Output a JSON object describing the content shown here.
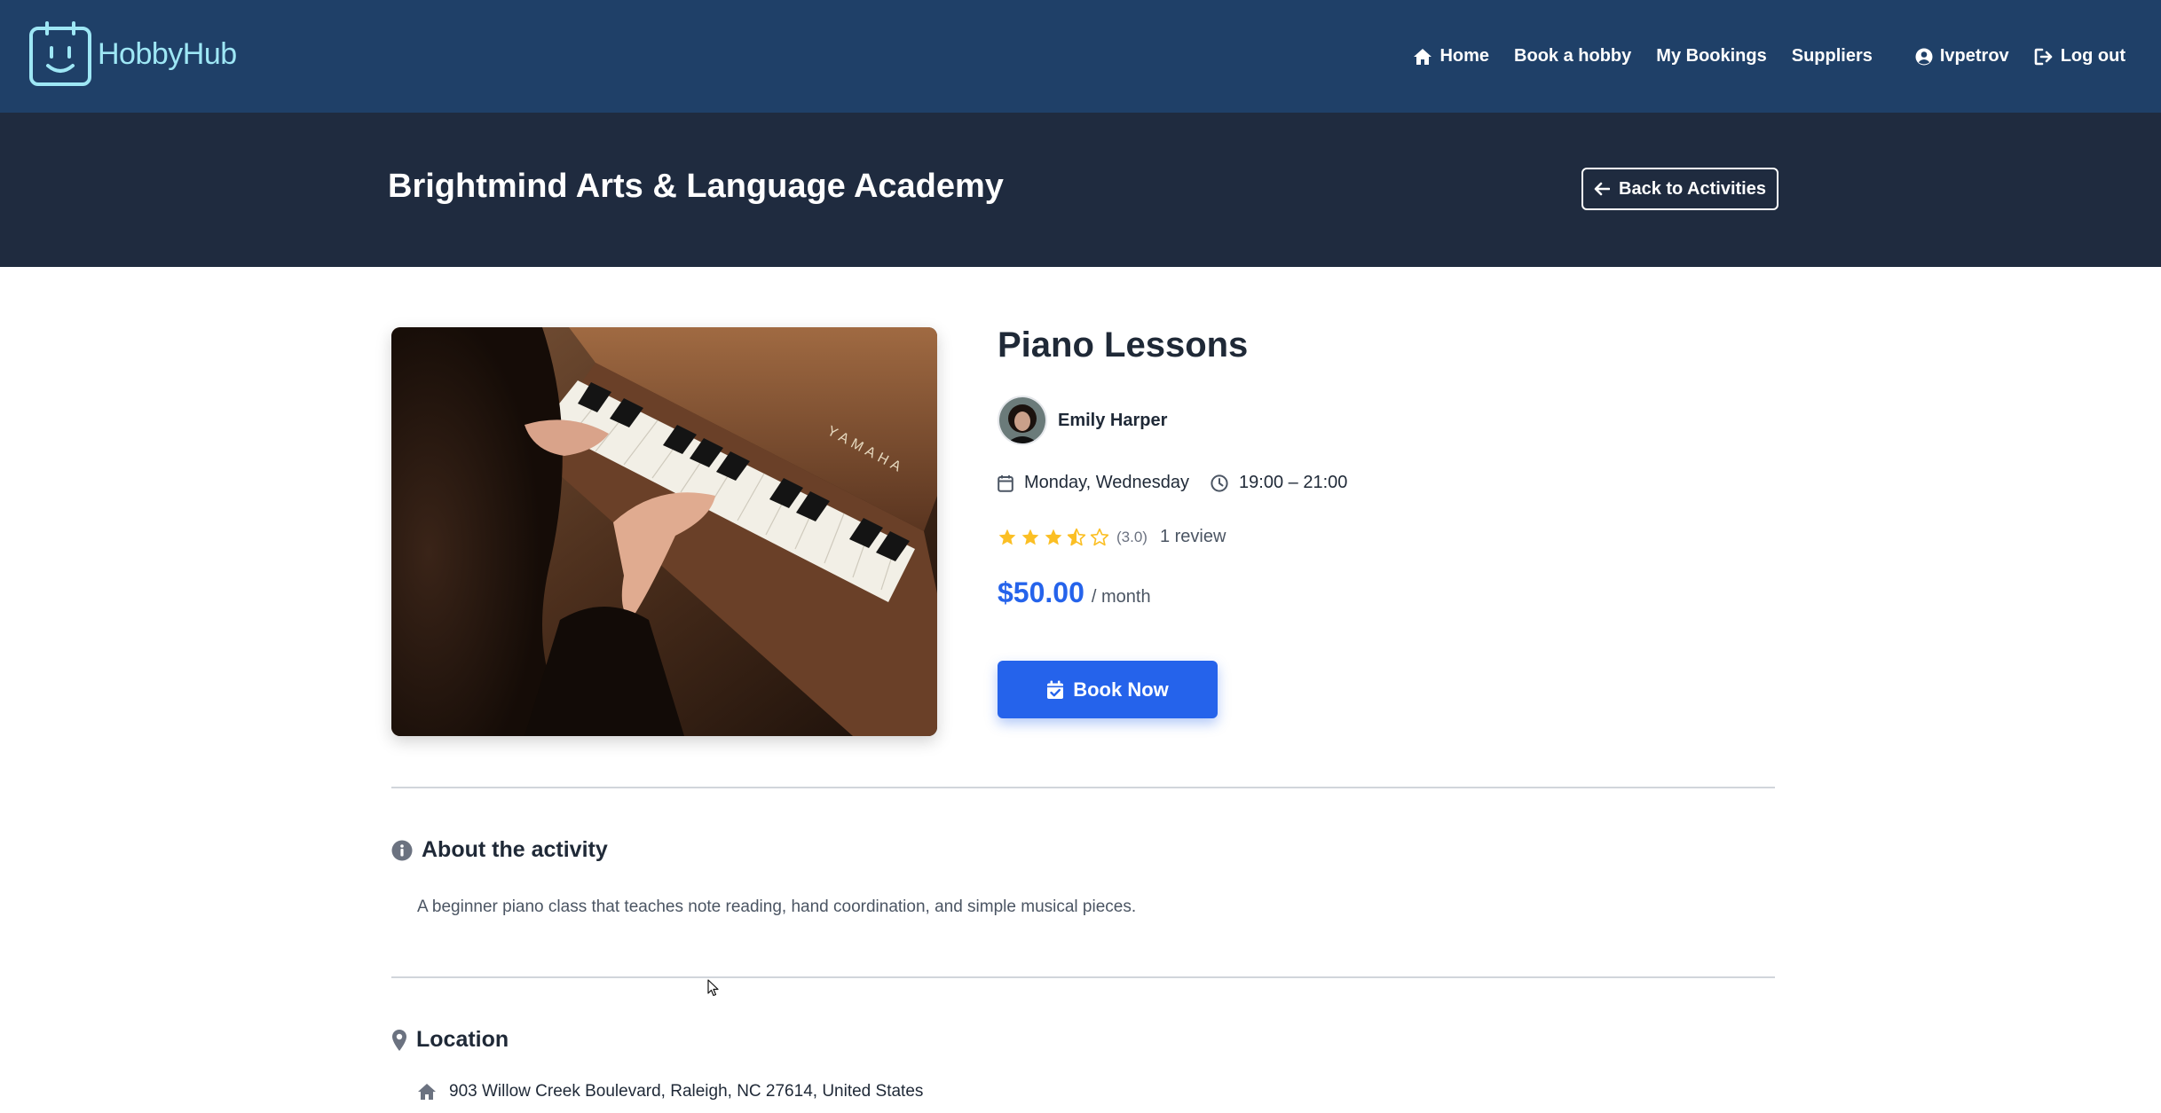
{
  "brand": {
    "name": "HobbyHub",
    "icon": "calendar-smile-icon"
  },
  "nav": {
    "home": "Home",
    "book_hobby": "Book a hobby",
    "my_bookings": "My Bookings",
    "suppliers": "Suppliers",
    "user": "Ivpetrov",
    "logout": "Log out"
  },
  "header": {
    "title": "Brightmind Arts & Language Academy",
    "back_label": "Back to Activities"
  },
  "activity": {
    "title": "Piano Lessons",
    "tutor": "Emily Harper",
    "days": "Monday, Wednesday",
    "time": "19:00 – 21:00",
    "rating_value": 3.5,
    "rating_text": "(3.0)",
    "review_count": "1 review",
    "price": "$50.00",
    "per": "/ month",
    "book_label": "Book Now"
  },
  "about": {
    "heading": "About the activity",
    "text": "A beginner piano class that teaches note reading, hand coordination, and simple musical pieces."
  },
  "location": {
    "heading": "Location",
    "address": "903 Willow Creek Boulevard, Raleigh, NC 27614, United States"
  },
  "colors": {
    "nav_bg": "#1f4068",
    "hero_bg": "#1f2b3f",
    "accent": "#2563eb",
    "star": "#fbbf24",
    "brand_text": "#9ee7f5"
  }
}
